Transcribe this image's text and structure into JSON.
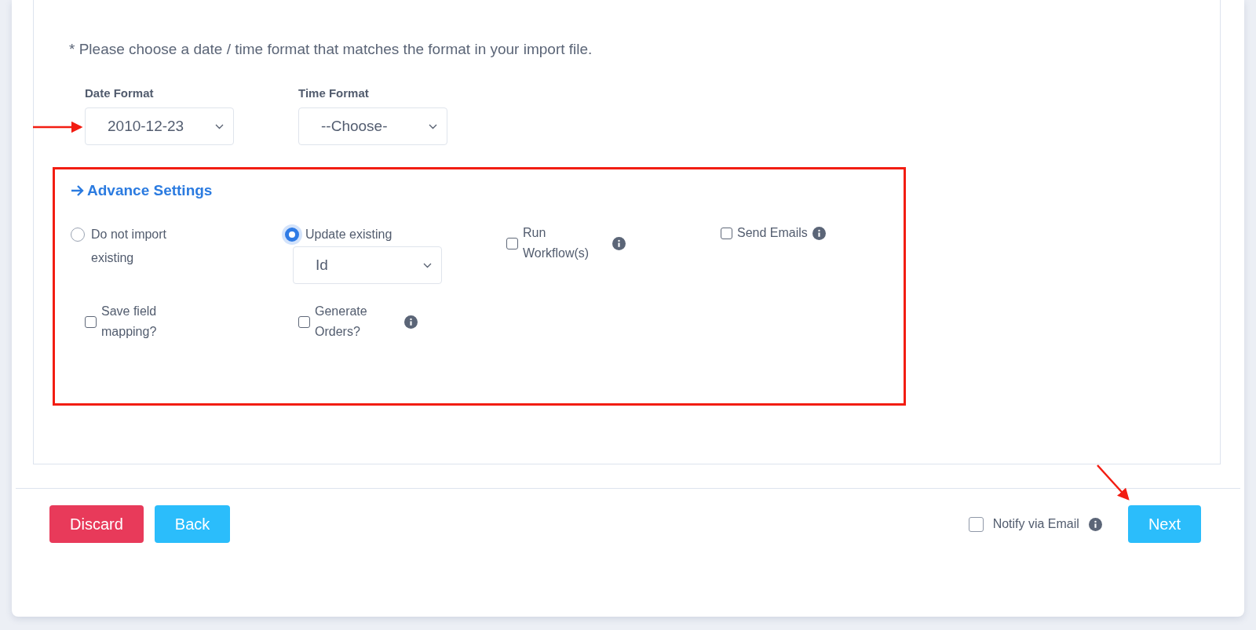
{
  "note": "* Please choose a date / time format that matches the format in your import file.",
  "formats": [
    {
      "label": "Date Format",
      "value": "2010-12-23"
    },
    {
      "label": "Time Format",
      "value": "--Choose-"
    }
  ],
  "advance_settings": {
    "title": "Advance Settings",
    "options": [
      {
        "kind": "radio",
        "label": "Do not import existing",
        "selected": false
      },
      {
        "kind": "radio",
        "label": "Update existing",
        "selected": true,
        "match_field": "Id"
      },
      {
        "kind": "checkbox",
        "label": "Run Workflow(s)",
        "checked": false,
        "info": true
      },
      {
        "kind": "checkbox",
        "label": "Send Emails",
        "checked": false,
        "info": true
      },
      {
        "kind": "checkbox",
        "label": "Save field mapping?",
        "checked": false,
        "info": false
      },
      {
        "kind": "checkbox",
        "label": "Generate Orders?",
        "checked": false,
        "info": true
      }
    ]
  },
  "footer": {
    "buttons": [
      {
        "label": "Discard",
        "kind": "danger"
      },
      {
        "label": "Back",
        "kind": "info"
      }
    ],
    "notify": {
      "label": "Notify via Email",
      "checked": false,
      "info": true
    },
    "next": {
      "label": "Next",
      "kind": "info"
    }
  }
}
